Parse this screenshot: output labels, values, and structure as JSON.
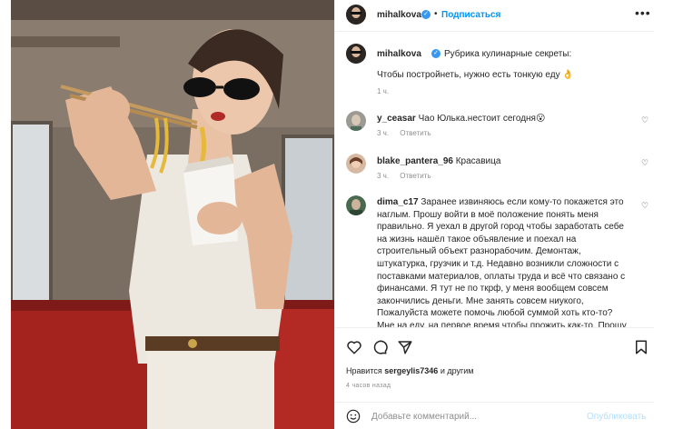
{
  "post": {
    "author": "mihalkova",
    "follow_label": "Подписаться",
    "more_label": "•••",
    "dot": "•"
  },
  "caption": {
    "username": "mihalkova",
    "title": "Рубрика кулинарные секреты:",
    "text": "Чтобы постройнеть, нужно есть тонкую еду 👌",
    "time": "1 ч."
  },
  "comments": [
    {
      "username": "y_ceasar",
      "text": "Чао Юлька.нестоит сегодня😮",
      "time": "3 ч.",
      "reply": "Ответить"
    },
    {
      "username": "blake_pantera_96",
      "text": "Красавица",
      "time": "3 ч.",
      "reply": "Ответить"
    },
    {
      "username": "dima_c17",
      "lines": [
        "Заранее извиняюсь если кому-то покажется это",
        "наглым. Прошу войти в моё положение понять меня",
        "правильно. Я уехал в другой город чтобы заработать себе",
        "на жизнь нашёл такое объявление и поехал на",
        "строительный объект разнорабочим. Демонтаж,",
        "штукатурка, грузчик и т.д. Недавно возникли сложности с",
        "поставками материалов, оплаты труда и всё что связано с",
        "финансами. Я тут не по ткрф, у меня вообщем совсем",
        "закончились деньги. Мне занять совсем ниукого,",
        "Пожалуйста можете помочь любой суммой хоть кто-то?",
        "Мне на еду, на первое время чтобы прожить как-то. Прошу"
      ]
    }
  ],
  "actions": {
    "likes_prefix": "Нравится",
    "likes_user": "sergeylis7346",
    "likes_suffix": "и другим",
    "time": "4 часов назад"
  },
  "comment_box": {
    "placeholder": "Добавьте комментарий...",
    "publish_label": "Опубликовать"
  },
  "colors": {
    "accent": "#0095f6",
    "verified": "#3897f0",
    "muted": "#8e8e8e",
    "publish_disabled": "#b2dffc"
  },
  "icons": [
    "heart-icon",
    "comment-icon",
    "share-icon",
    "bookmark-icon",
    "emoji-icon",
    "verified-badge-icon",
    "more-options-icon"
  ]
}
